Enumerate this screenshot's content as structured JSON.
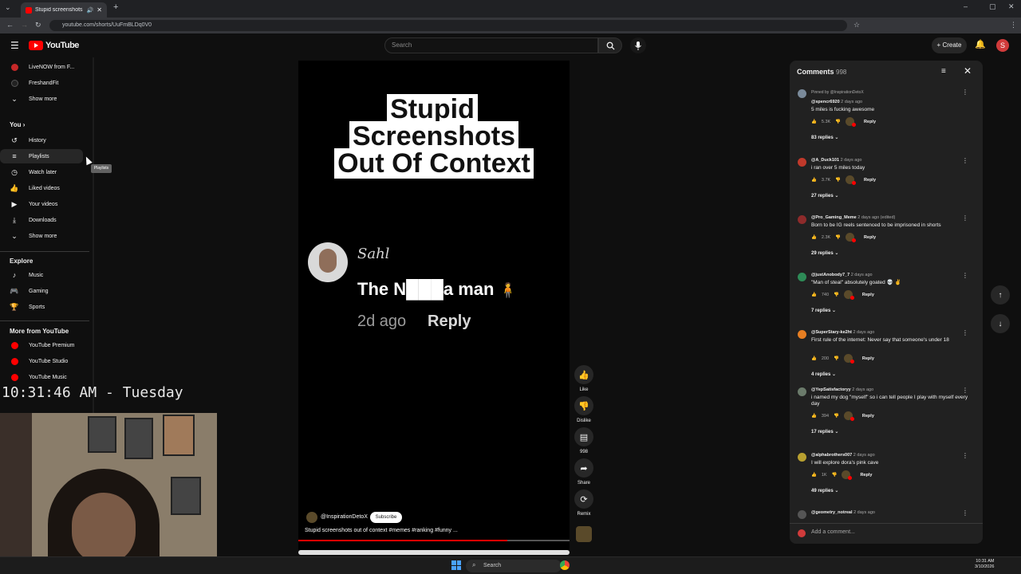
{
  "browser": {
    "tab_title": "Stupid screenshots out of c",
    "url": "youtube.com/shorts/UuFmBLDq0V0"
  },
  "header": {
    "logo_text": "YouTube",
    "search_placeholder": "Search",
    "create_label": "Create",
    "avatar_letter": "S"
  },
  "sidebar": {
    "subscriptions": [
      {
        "label": "LiveNOW from F..."
      },
      {
        "label": "FreshandFit"
      }
    ],
    "show_more_1": "Show more",
    "you_heading": "You",
    "you_items": [
      {
        "label": "History",
        "icon": "history-icon"
      },
      {
        "label": "Playlists",
        "icon": "playlists-icon"
      },
      {
        "label": "Watch later",
        "icon": "watch-later-icon"
      },
      {
        "label": "Liked videos",
        "icon": "thumbs-up-icon"
      },
      {
        "label": "Your videos",
        "icon": "your-videos-icon"
      },
      {
        "label": "Downloads",
        "icon": "download-icon"
      }
    ],
    "show_more_2": "Show more",
    "explore_heading": "Explore",
    "explore_items": [
      {
        "label": "Music",
        "icon": "music-note-icon"
      },
      {
        "label": "Gaming",
        "icon": "gamepad-icon"
      },
      {
        "label": "Sports",
        "icon": "trophy-icon"
      }
    ],
    "more_heading": "More from YouTube",
    "more_items": [
      {
        "label": "YouTube Premium"
      },
      {
        "label": "YouTube Studio"
      },
      {
        "label": "YouTube Music"
      }
    ],
    "tooltip": "Playlists"
  },
  "overlay_clock": "10:31:46 AM - Tuesday",
  "short": {
    "title_line1": "Stupid Screenshots",
    "title_line2": "Out Of Context",
    "comment_author": "Sahl",
    "comment_text": "The N███a man",
    "comment_ago": "2d ago",
    "comment_reply": "Reply",
    "channel": "@InspirationDetoX",
    "subscribe": "Subscribe",
    "description": "Stupid screenshots out of context #memes #ranking #funny ...",
    "progress": 0.77
  },
  "actions": {
    "like": "Like",
    "dislike": "Dislike",
    "comments_count": "998",
    "share": "Share",
    "remix": "Remix"
  },
  "comments": {
    "title": "Comments",
    "count": "998",
    "add_placeholder": "Add a comment...",
    "items": [
      {
        "pinned": "Pinned by @InspirationDetoX",
        "author": "@spencr6920",
        "ago": "2 days ago",
        "text": "5 miles is fucking awesome",
        "likes": "5.3K",
        "replies": "83 replies",
        "av": "#7a8a9a"
      },
      {
        "pinned": "",
        "author": "@A_Duck101",
        "ago": "2 days ago",
        "text": "i ran over 5 miles today",
        "likes": "3.7K",
        "replies": "27 replies",
        "av": "#c0392b"
      },
      {
        "pinned": "",
        "author": "@Pro_Gaming_Meme",
        "ago": "2 days ago (edited)",
        "text": "Born to be IG reels sentenced to be imprisoned in shorts",
        "likes": "2.3K",
        "replies": "29 replies",
        "av": "#8e2b2b"
      },
      {
        "pinned": "",
        "author": "@justAnobody7_7",
        "ago": "2 days ago",
        "text": "\"Man of steal\" absolutely goated 💀 ✌️",
        "likes": "740",
        "replies": "7 replies",
        "av": "#2e8b57"
      },
      {
        "pinned": "",
        "author": "@SuperStary-ke2ht",
        "ago": "2 days ago",
        "text": "First rule of the internet: Never say that someone's under 18",
        "likes": "200",
        "replies": "4 replies",
        "av": "#e67e22"
      },
      {
        "pinned": "",
        "author": "@YepSatisfactoryy",
        "ago": "2 days ago",
        "text": "i named my dog \"myself\" so i can tell people I play with myself every day",
        "likes": "394",
        "replies": "17 replies",
        "av": "#6b7b6b"
      },
      {
        "pinned": "",
        "author": "@alphabrothers007",
        "ago": "2 days ago",
        "text": "I will explore dora's pink cave",
        "likes": "1K",
        "replies": "49 replies",
        "av": "#b8a030"
      },
      {
        "pinned": "",
        "author": "@geometry_notreal",
        "ago": "2 days ago",
        "text": "",
        "likes": "",
        "replies": "",
        "av": "#555"
      }
    ]
  },
  "taskbar": {
    "search": "Search",
    "time": "10:31 AM",
    "date": "3/10/2026"
  }
}
